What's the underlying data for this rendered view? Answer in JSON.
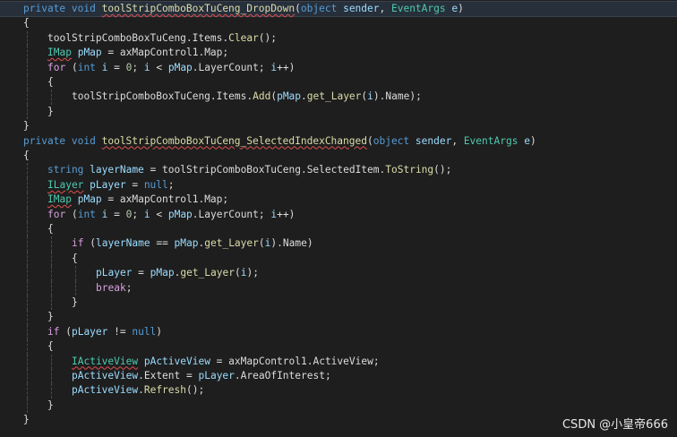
{
  "code_lines": [
    {
      "indent": 0,
      "highlight": true,
      "tokens": [
        [
          "private",
          "keyword"
        ],
        [
          " ",
          "plain"
        ],
        [
          "void",
          "keyword"
        ],
        [
          " ",
          "plain"
        ],
        [
          "toolStripComboBoxTuCeng_DropDown",
          "method"
        ],
        [
          "(",
          "plain"
        ],
        [
          "object",
          "keyword"
        ],
        [
          " ",
          "plain"
        ],
        [
          "sender",
          "param"
        ],
        [
          ", ",
          "plain"
        ],
        [
          "EventArgs",
          "type"
        ],
        [
          " ",
          "plain"
        ],
        [
          "e",
          "param"
        ],
        [
          ")",
          "plain"
        ]
      ]
    },
    {
      "indent": 0,
      "tokens": [
        [
          "{",
          "plain"
        ]
      ]
    },
    {
      "indent": 1,
      "tokens": [
        [
          "toolStripComboBoxTuCeng",
          "field"
        ],
        [
          ".",
          "plain"
        ],
        [
          "Items",
          "field"
        ],
        [
          ".",
          "plain"
        ],
        [
          "Clear",
          "method"
        ],
        [
          "();",
          "plain"
        ]
      ]
    },
    {
      "indent": 1,
      "tokens": [
        [
          "IMap",
          "type"
        ],
        [
          " ",
          "plain"
        ],
        [
          "pMap",
          "local"
        ],
        [
          " = ",
          "plain"
        ],
        [
          "axMapControl1",
          "field"
        ],
        [
          ".",
          "plain"
        ],
        [
          "Map",
          "field"
        ],
        [
          ";",
          "plain"
        ]
      ]
    },
    {
      "indent": 1,
      "tokens": [
        [
          "for",
          "control"
        ],
        [
          " (",
          "plain"
        ],
        [
          "int",
          "keyword"
        ],
        [
          " ",
          "plain"
        ],
        [
          "i",
          "local"
        ],
        [
          " = ",
          "plain"
        ],
        [
          "0",
          "number"
        ],
        [
          "; ",
          "plain"
        ],
        [
          "i",
          "local"
        ],
        [
          " < ",
          "plain"
        ],
        [
          "pMap",
          "local"
        ],
        [
          ".",
          "plain"
        ],
        [
          "LayerCount",
          "field"
        ],
        [
          "; ",
          "plain"
        ],
        [
          "i",
          "local"
        ],
        [
          "++)",
          "plain"
        ]
      ]
    },
    {
      "indent": 1,
      "tokens": [
        [
          "{",
          "plain"
        ]
      ]
    },
    {
      "indent": 2,
      "tokens": [
        [
          "toolStripComboBoxTuCeng",
          "field"
        ],
        [
          ".",
          "plain"
        ],
        [
          "Items",
          "field"
        ],
        [
          ".",
          "plain"
        ],
        [
          "Add",
          "method"
        ],
        [
          "(",
          "plain"
        ],
        [
          "pMap",
          "local"
        ],
        [
          ".",
          "plain"
        ],
        [
          "get_Layer",
          "method"
        ],
        [
          "(",
          "plain"
        ],
        [
          "i",
          "local"
        ],
        [
          ").",
          "plain"
        ],
        [
          "Name",
          "field"
        ],
        [
          ");",
          "plain"
        ]
      ]
    },
    {
      "indent": 1,
      "tokens": [
        [
          "}",
          "plain"
        ]
      ]
    },
    {
      "indent": 0,
      "tokens": [
        [
          "}",
          "plain"
        ]
      ]
    },
    {
      "indent": 0,
      "tokens": [
        [
          "private",
          "keyword"
        ],
        [
          " ",
          "plain"
        ],
        [
          "void",
          "keyword"
        ],
        [
          " ",
          "plain"
        ],
        [
          "toolStripComboBoxTuCeng_SelectedIndexChanged",
          "method"
        ],
        [
          "(",
          "plain"
        ],
        [
          "object",
          "keyword"
        ],
        [
          " ",
          "plain"
        ],
        [
          "sender",
          "param"
        ],
        [
          ", ",
          "plain"
        ],
        [
          "EventArgs",
          "type"
        ],
        [
          " ",
          "plain"
        ],
        [
          "e",
          "param"
        ],
        [
          ")",
          "plain"
        ]
      ]
    },
    {
      "indent": 0,
      "tokens": [
        [
          "{",
          "plain"
        ]
      ]
    },
    {
      "indent": 1,
      "tokens": [
        [
          "string",
          "keyword"
        ],
        [
          " ",
          "plain"
        ],
        [
          "layerName",
          "local"
        ],
        [
          " = ",
          "plain"
        ],
        [
          "toolStripComboBoxTuCeng",
          "field"
        ],
        [
          ".",
          "plain"
        ],
        [
          "SelectedItem",
          "field"
        ],
        [
          ".",
          "plain"
        ],
        [
          "ToString",
          "method"
        ],
        [
          "();",
          "plain"
        ]
      ]
    },
    {
      "indent": 1,
      "tokens": [
        [
          "ILayer",
          "type"
        ],
        [
          " ",
          "plain"
        ],
        [
          "pLayer",
          "local"
        ],
        [
          " = ",
          "plain"
        ],
        [
          "null",
          "keyword"
        ],
        [
          ";",
          "plain"
        ]
      ]
    },
    {
      "indent": 1,
      "tokens": [
        [
          "IMap",
          "type"
        ],
        [
          " ",
          "plain"
        ],
        [
          "pMap",
          "local"
        ],
        [
          " = ",
          "plain"
        ],
        [
          "axMapControl1",
          "field"
        ],
        [
          ".",
          "plain"
        ],
        [
          "Map",
          "field"
        ],
        [
          ";",
          "plain"
        ]
      ]
    },
    {
      "indent": 1,
      "tokens": [
        [
          "for",
          "control"
        ],
        [
          " (",
          "plain"
        ],
        [
          "int",
          "keyword"
        ],
        [
          " ",
          "plain"
        ],
        [
          "i",
          "local"
        ],
        [
          " = ",
          "plain"
        ],
        [
          "0",
          "number"
        ],
        [
          "; ",
          "plain"
        ],
        [
          "i",
          "local"
        ],
        [
          " < ",
          "plain"
        ],
        [
          "pMap",
          "local"
        ],
        [
          ".",
          "plain"
        ],
        [
          "LayerCount",
          "field"
        ],
        [
          "; ",
          "plain"
        ],
        [
          "i",
          "local"
        ],
        [
          "++)",
          "plain"
        ]
      ]
    },
    {
      "indent": 1,
      "tokens": [
        [
          "{",
          "plain"
        ]
      ]
    },
    {
      "indent": 2,
      "tokens": [
        [
          "if",
          "control"
        ],
        [
          " (",
          "plain"
        ],
        [
          "layerName",
          "local"
        ],
        [
          " == ",
          "plain"
        ],
        [
          "pMap",
          "local"
        ],
        [
          ".",
          "plain"
        ],
        [
          "get_Layer",
          "method"
        ],
        [
          "(",
          "plain"
        ],
        [
          "i",
          "local"
        ],
        [
          ").",
          "plain"
        ],
        [
          "Name",
          "field"
        ],
        [
          ")",
          "plain"
        ]
      ]
    },
    {
      "indent": 2,
      "tokens": [
        [
          "{",
          "plain"
        ]
      ]
    },
    {
      "indent": 3,
      "tokens": [
        [
          "pLayer",
          "local"
        ],
        [
          " = ",
          "plain"
        ],
        [
          "pMap",
          "local"
        ],
        [
          ".",
          "plain"
        ],
        [
          "get_Layer",
          "method"
        ],
        [
          "(",
          "plain"
        ],
        [
          "i",
          "local"
        ],
        [
          ");",
          "plain"
        ]
      ]
    },
    {
      "indent": 3,
      "tokens": [
        [
          "break",
          "control"
        ],
        [
          ";",
          "plain"
        ]
      ]
    },
    {
      "indent": 2,
      "tokens": [
        [
          "}",
          "plain"
        ]
      ]
    },
    {
      "indent": 1,
      "tokens": [
        [
          "}",
          "plain"
        ]
      ]
    },
    {
      "indent": 1,
      "tokens": [
        [
          "if",
          "control"
        ],
        [
          " (",
          "plain"
        ],
        [
          "pLayer",
          "local"
        ],
        [
          " != ",
          "plain"
        ],
        [
          "null",
          "keyword"
        ],
        [
          ")",
          "plain"
        ]
      ]
    },
    {
      "indent": 1,
      "tokens": [
        [
          "{",
          "plain"
        ]
      ]
    },
    {
      "indent": 2,
      "tokens": [
        [
          "IActiveView",
          "type"
        ],
        [
          " ",
          "plain"
        ],
        [
          "pActiveView",
          "local"
        ],
        [
          " = ",
          "plain"
        ],
        [
          "axMapControl1",
          "field"
        ],
        [
          ".",
          "plain"
        ],
        [
          "ActiveView",
          "field"
        ],
        [
          ";",
          "plain"
        ]
      ]
    },
    {
      "indent": 2,
      "tokens": [
        [
          "pActiveView",
          "local"
        ],
        [
          ".",
          "plain"
        ],
        [
          "Extent",
          "field"
        ],
        [
          " = ",
          "plain"
        ],
        [
          "pLayer",
          "local"
        ],
        [
          ".",
          "plain"
        ],
        [
          "AreaOfInterest",
          "field"
        ],
        [
          ";",
          "plain"
        ]
      ]
    },
    {
      "indent": 2,
      "tokens": [
        [
          "pActiveView",
          "local"
        ],
        [
          ".",
          "plain"
        ],
        [
          "Refresh",
          "method"
        ],
        [
          "();",
          "plain"
        ]
      ]
    },
    {
      "indent": 1,
      "tokens": [
        [
          "}",
          "plain"
        ]
      ]
    },
    {
      "indent": 0,
      "tokens": [
        [
          "}",
          "plain"
        ]
      ]
    }
  ],
  "squiggles": [
    "IMap",
    "ILayer",
    "IActiveView",
    "toolStripComboBoxTuCeng_DropDown",
    "toolStripComboBoxTuCeng_SelectedIndexChanged"
  ],
  "watermark": "CSDN @小皇帝666",
  "colors": {
    "background": "#1e1e1e",
    "keyword": "#569cd6",
    "type": "#4ec9b0",
    "method": "#dcdcaa",
    "local": "#9cdcfe",
    "control": "#d8a0df",
    "number": "#b5cea8",
    "text": "#dcdcdc",
    "squiggle": "#e05050"
  }
}
